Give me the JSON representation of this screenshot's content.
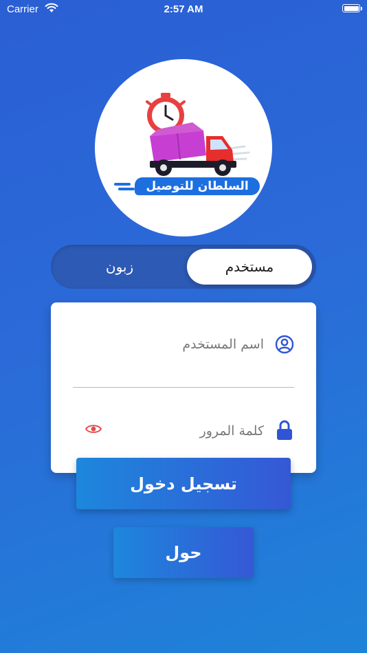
{
  "status_bar": {
    "carrier": "Carrier",
    "time": "2:57 AM"
  },
  "logo": {
    "text": "السلطان للتوصيل"
  },
  "segment": {
    "selected": "مستخدم",
    "other": "زبون"
  },
  "login_form": {
    "username_placeholder": "اسم المستخدم",
    "password_placeholder": "كلمة المرور"
  },
  "buttons": {
    "login": "تسجيل دخول",
    "about": "حول"
  },
  "colors": {
    "accent": "#2f55d4",
    "eye_icon": "#e34b4b"
  },
  "icons": {
    "user": "user-circle-icon",
    "lock": "lock-icon",
    "eye": "eye-icon"
  }
}
